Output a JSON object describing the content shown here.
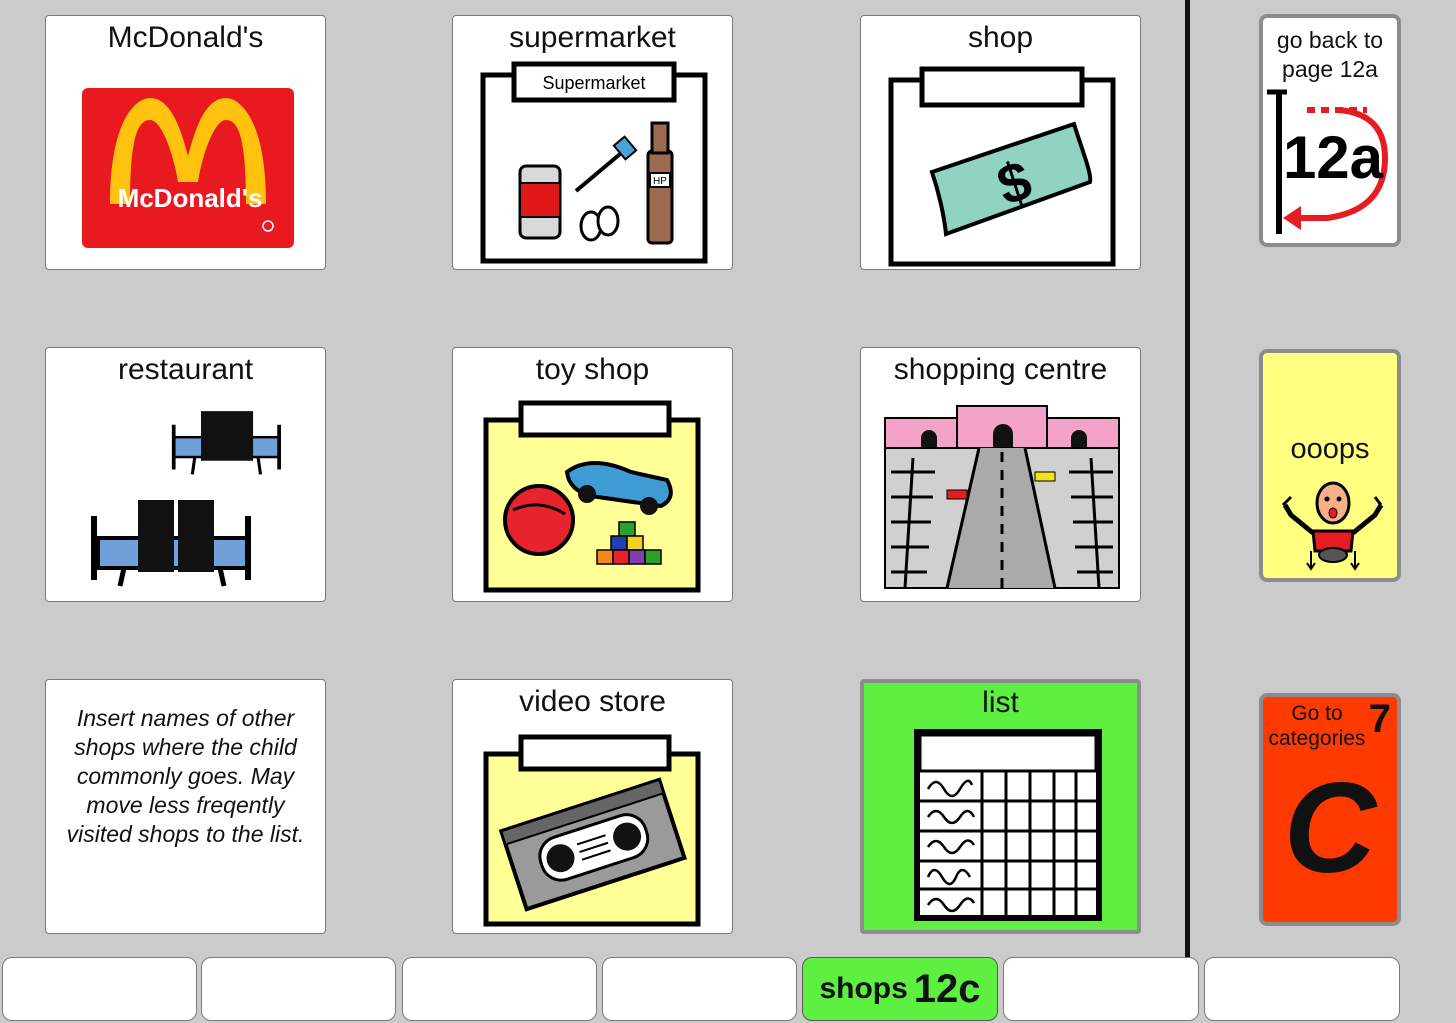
{
  "grid": {
    "mcdonalds": {
      "label": "McDonald's",
      "logo_text": "McDonald's"
    },
    "supermarket": {
      "label": "supermarket",
      "sign_text": "Supermarket",
      "bottle_text": "HP"
    },
    "shop": {
      "label": "shop",
      "money_symbol": "$"
    },
    "restaurant": {
      "label": "restaurant"
    },
    "toy_shop": {
      "label": "toy shop"
    },
    "shopping_centre": {
      "label": "shopping centre"
    },
    "note": {
      "text": "Insert names  of other shops where the child commonly goes. May move less freqently visited shops to the list."
    },
    "video_store": {
      "label": "video store"
    },
    "list": {
      "label": "list"
    }
  },
  "sidebar": {
    "go_back": {
      "label": "go back to page 12a",
      "page_code": "12a"
    },
    "ooops": {
      "label": "ooops"
    },
    "categories": {
      "label": "Go to categories",
      "number": "7",
      "letter": "C"
    }
  },
  "tabs": {
    "active": {
      "label": "shops",
      "page_code": "12c"
    }
  },
  "colors": {
    "background": "#cbcbcb",
    "active_tab": "#5ef040",
    "list_tile": "#5ef040",
    "ooops": "#ffff80",
    "categories": "#ff3a00"
  }
}
